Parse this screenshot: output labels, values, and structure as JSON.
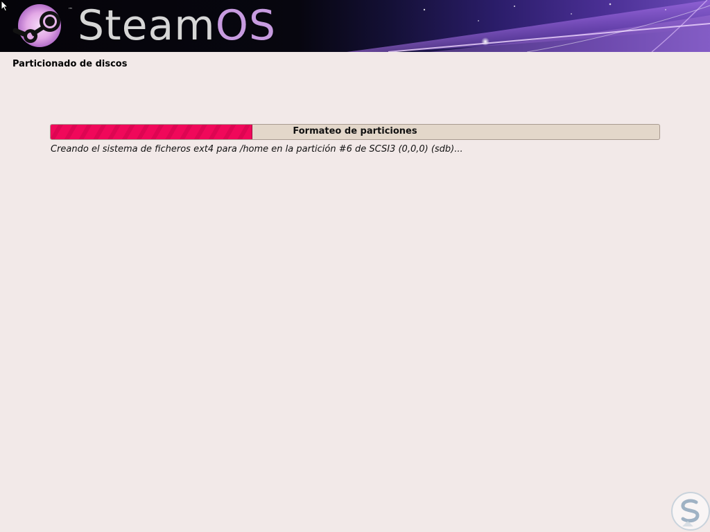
{
  "header": {
    "brand_steam": "Steam",
    "brand_os": "OS",
    "trademark": "™",
    "logo_icon": "steam-logo-icon",
    "colors": {
      "brand_text": "#d6d6d6",
      "brand_os": "#c79be0"
    }
  },
  "installer": {
    "section_title": "Particionado de discos",
    "progress": {
      "label": "Formateo de particiones",
      "fraction": 0.33,
      "color": "#f0085a"
    },
    "status_text": "Creando el sistema de ficheros ext4 para /home en la partición #6 de SCSI3 (0,0,0) (sdb)..."
  },
  "icons": {
    "cursor": "mouse-pointer-icon",
    "watermark": "watermark-s-logo-icon"
  },
  "colors": {
    "background": "#f2e9e8",
    "progress_track": "#e3d7ca"
  }
}
